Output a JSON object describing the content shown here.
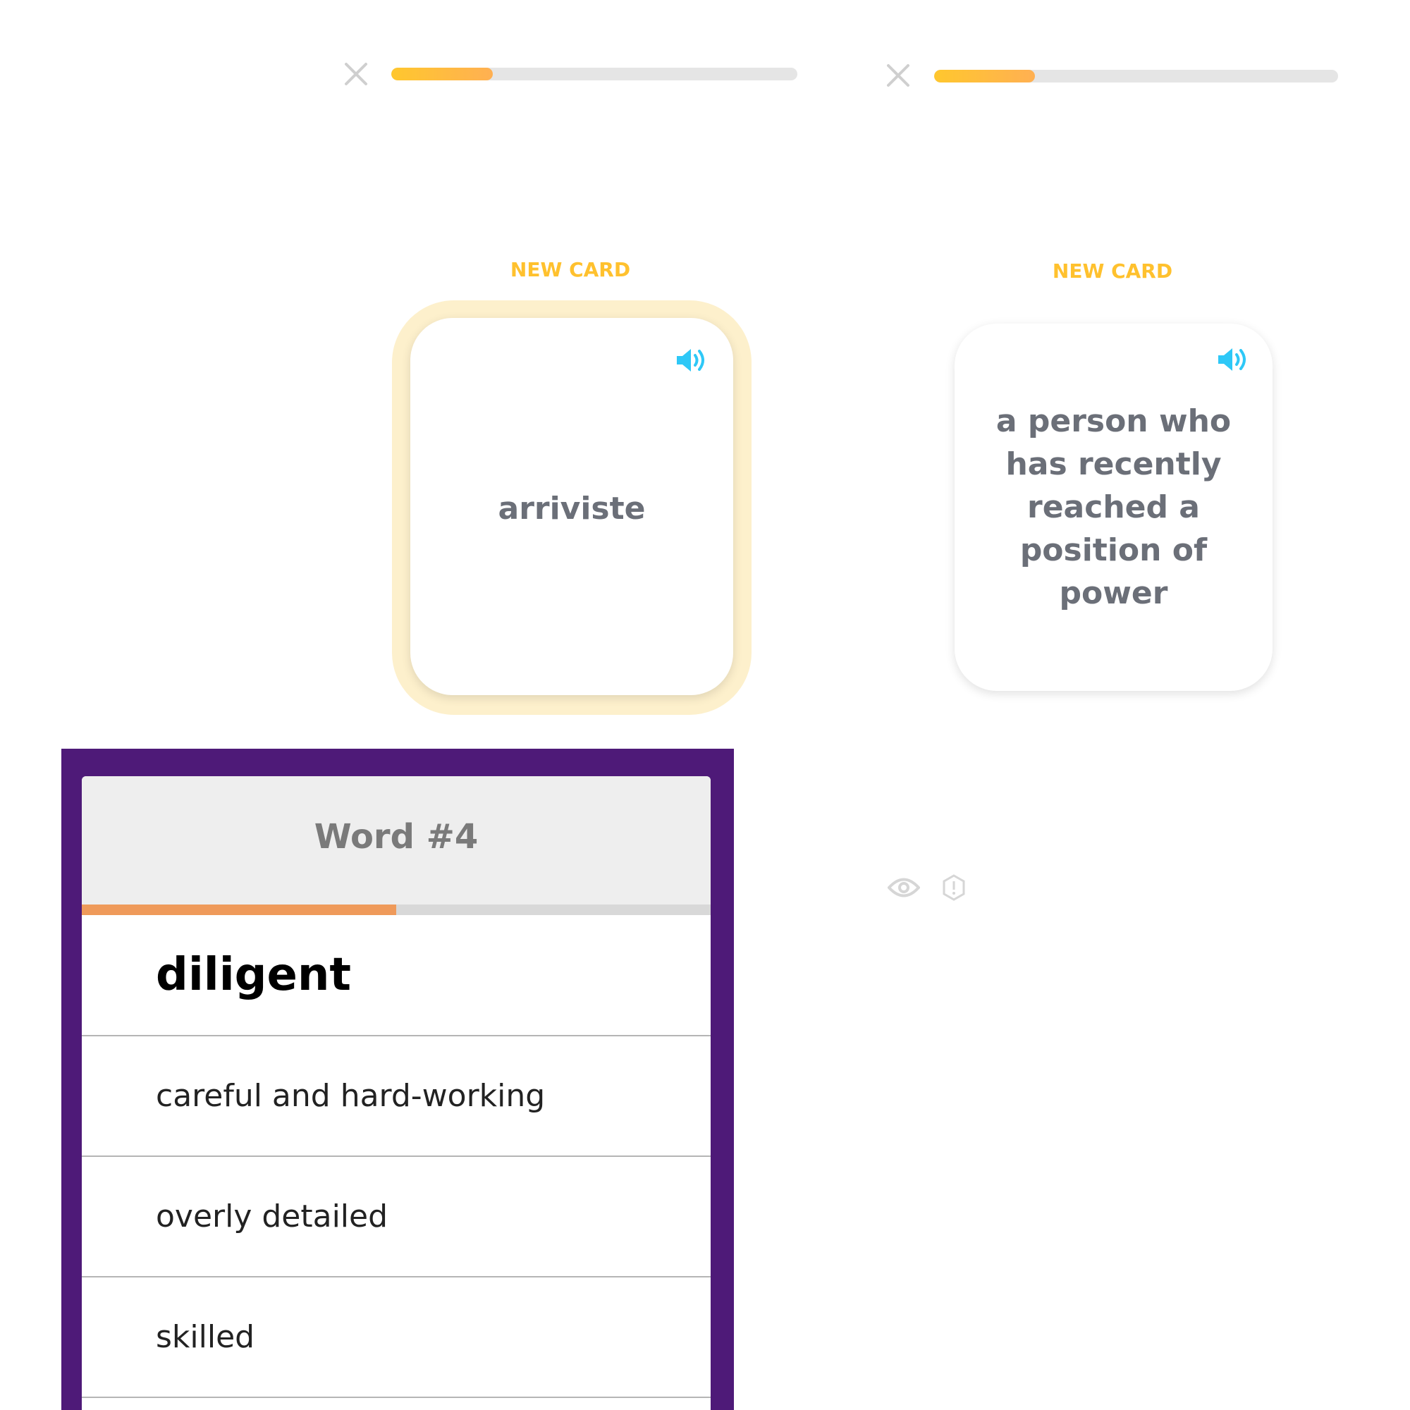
{
  "left_screen": {
    "progress": 0.25,
    "label": "NEW CARD",
    "card_text": "arriviste"
  },
  "right_screen": {
    "progress": 0.25,
    "label": "NEW CARD",
    "card_text": "a person who has recently reached a position of power"
  },
  "quiz": {
    "title": "Word #4",
    "progress": 0.5,
    "word": "diligent",
    "options": [
      "careful and hard-working",
      "overly detailed",
      "skilled"
    ]
  },
  "colors": {
    "accent": "#ffc12e",
    "speaker": "#2ec8f7",
    "purple": "#4e1a78",
    "quiz_progress": "#ef9a5a"
  }
}
